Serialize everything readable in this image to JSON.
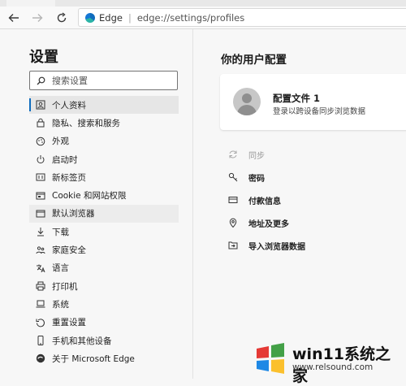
{
  "browser": {
    "site_name": "Edge",
    "url": "edge://settings/profiles"
  },
  "sidebar": {
    "title": "设置",
    "search_placeholder": "搜索设置",
    "items": [
      {
        "label": "个人资料",
        "icon": "profile-icon",
        "state": "active"
      },
      {
        "label": "隐私、搜索和服务",
        "icon": "lock-icon"
      },
      {
        "label": "外观",
        "icon": "palette-icon"
      },
      {
        "label": "启动时",
        "icon": "power-icon"
      },
      {
        "label": "新标签页",
        "icon": "new-tab-icon"
      },
      {
        "label": "Cookie 和网站权限",
        "icon": "site-permissions-icon"
      },
      {
        "label": "默认浏览器",
        "icon": "browser-icon",
        "state": "hover"
      },
      {
        "label": "下载",
        "icon": "download-icon"
      },
      {
        "label": "家庭安全",
        "icon": "family-icon"
      },
      {
        "label": "语言",
        "icon": "language-icon"
      },
      {
        "label": "打印机",
        "icon": "printer-icon"
      },
      {
        "label": "系统",
        "icon": "laptop-icon"
      },
      {
        "label": "重置设置",
        "icon": "reset-icon"
      },
      {
        "label": "手机和其他设备",
        "icon": "phone-icon"
      },
      {
        "label": "关于 Microsoft Edge",
        "icon": "edge-logo-icon"
      }
    ]
  },
  "main": {
    "title": "你的用户配置",
    "profile": {
      "name": "配置文件 1",
      "subtitle": "登录以跨设备同步浏览数据"
    },
    "menu": [
      {
        "label": "同步",
        "icon": "sync-icon",
        "disabled": true
      },
      {
        "label": "密码",
        "icon": "key-icon"
      },
      {
        "label": "付款信息",
        "icon": "card-icon"
      },
      {
        "label": "地址及更多",
        "icon": "location-icon"
      },
      {
        "label": "导入浏览器数据",
        "icon": "import-icon"
      }
    ]
  },
  "watermark": {
    "title": "win11系统之家",
    "url": "www.relsound.com"
  }
}
